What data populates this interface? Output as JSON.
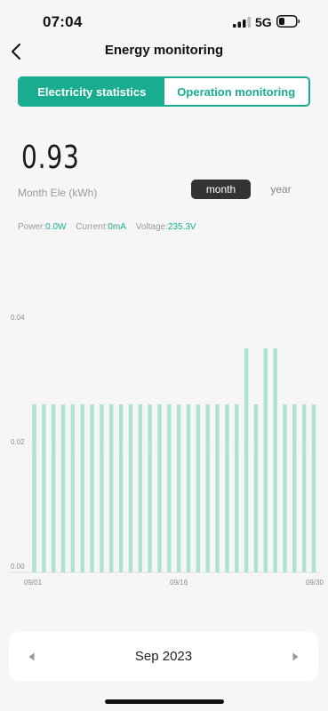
{
  "status_bar": {
    "time": "07:04",
    "network": "5G"
  },
  "nav": {
    "title": "Energy monitoring",
    "back_icon": "chevron-left-icon"
  },
  "tabs": [
    {
      "label": "Electricity statistics",
      "active": true
    },
    {
      "label": "Operation monitoring",
      "active": false
    }
  ],
  "summary": {
    "value": "0.93",
    "label": "Month Ele (kWh)"
  },
  "period": {
    "month_label": "month",
    "year_label": "year",
    "selected": "month"
  },
  "metrics": [
    {
      "label": "Power:",
      "value": "0.0W"
    },
    {
      "label": "Current:",
      "value": "0mA"
    },
    {
      "label": "Voltage:",
      "value": "235.3V"
    }
  ],
  "month_selector": {
    "label": "Sep 2023",
    "prev_icon": "triangle-left-icon",
    "next_icon": "triangle-right-icon"
  },
  "colors": {
    "accent": "#19ad8f",
    "bar": "#ade2d4"
  },
  "chart_data": {
    "type": "bar",
    "x": [
      "09/01",
      "09/02",
      "09/03",
      "09/04",
      "09/05",
      "09/06",
      "09/07",
      "09/08",
      "09/09",
      "09/10",
      "09/11",
      "09/12",
      "09/13",
      "09/14",
      "09/15",
      "09/16",
      "09/17",
      "09/18",
      "09/19",
      "09/20",
      "09/21",
      "09/22",
      "09/23",
      "09/24",
      "09/25",
      "09/26",
      "09/27",
      "09/28",
      "09/29",
      "09/30"
    ],
    "values": [
      0.027,
      0.027,
      0.027,
      0.027,
      0.027,
      0.027,
      0.027,
      0.027,
      0.027,
      0.027,
      0.027,
      0.027,
      0.027,
      0.027,
      0.027,
      0.027,
      0.027,
      0.027,
      0.027,
      0.027,
      0.027,
      0.027,
      0.036,
      0.027,
      0.036,
      0.036,
      0.027,
      0.027,
      0.027,
      0.027
    ],
    "x_tick_labels": [
      "09/01",
      "09/16",
      "09/30"
    ],
    "y_ticks": [
      0,
      0.02,
      0.04
    ],
    "y_tick_labels": [
      "0.00",
      "0.02",
      "0.04"
    ],
    "ylim": [
      0,
      0.04
    ],
    "grid": true
  }
}
